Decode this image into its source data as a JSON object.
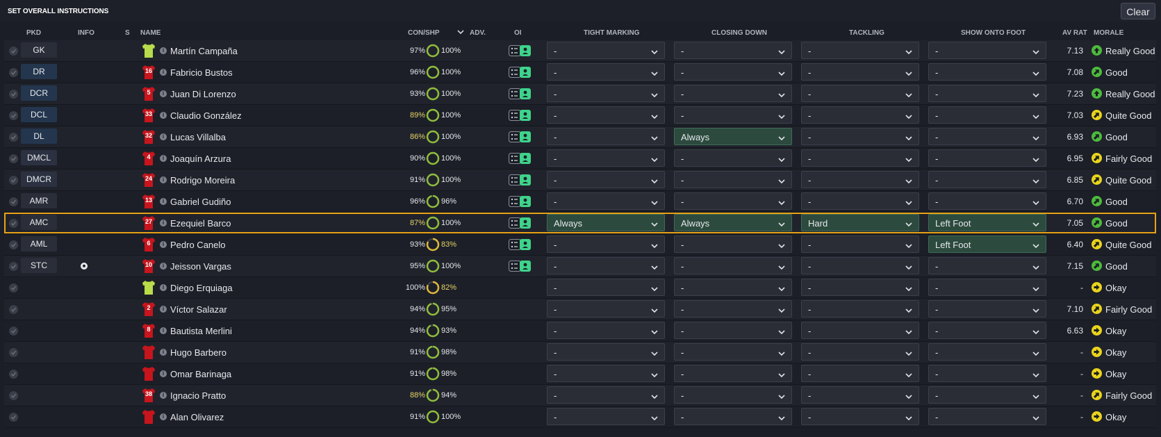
{
  "title": "SET OVERALL INSTRUCTIONS",
  "clear_label": "Clear",
  "columns": {
    "pkd": "PKD",
    "info": "INFO",
    "s": "S",
    "name": "NAME",
    "con_shp": "CON/SHP",
    "adv": "ADV.",
    "oi": "OI",
    "tight_marking": "TIGHT MARKING",
    "closing_down": "CLOSING DOWN",
    "tackling": "TACKLING",
    "show_onto_foot": "SHOW ONTO FOOT",
    "av_rat": "AV RAT",
    "morale": "MORALE"
  },
  "colors": {
    "highlight": "#e8a317",
    "active_dropdown": "#2c4a3e",
    "morale_green": "#4dbb3c",
    "morale_yellow": "#e9d41c",
    "ring_green": "#8fbd3a",
    "ring_yellow": "#e0b93a"
  },
  "players": [
    {
      "pos": "GK",
      "shirt": "",
      "kit": "gk",
      "name": "Martín Campaña",
      "con": "97%",
      "con_level": 0.97,
      "shp": "100%",
      "shp_level": 1.0,
      "oi": true,
      "tight": "-",
      "closing": "-",
      "tackling": "-",
      "foot": "-",
      "rating": "7.13",
      "morale": "Really Good",
      "morale_icon": "arrow-up-green"
    },
    {
      "pos": "DR",
      "shirt": "16",
      "kit": "red",
      "name": "Fabricio Bustos",
      "con": "96%",
      "con_level": 0.96,
      "shp": "100%",
      "shp_level": 1.0,
      "oi": true,
      "tight": "-",
      "closing": "-",
      "tackling": "-",
      "foot": "-",
      "rating": "7.08",
      "morale": "Good",
      "morale_icon": "arrow-green"
    },
    {
      "pos": "DCR",
      "shirt": "5",
      "kit": "red",
      "name": "Juan Di Lorenzo",
      "con": "93%",
      "con_level": 0.93,
      "shp": "100%",
      "shp_level": 1.0,
      "oi": true,
      "tight": "-",
      "closing": "-",
      "tackling": "-",
      "foot": "-",
      "rating": "7.23",
      "morale": "Really Good",
      "morale_icon": "arrow-up-green"
    },
    {
      "pos": "DCL",
      "shirt": "33",
      "kit": "red",
      "name": "Claudio González",
      "con": "89%",
      "con_level": 0.89,
      "shp": "100%",
      "shp_level": 1.0,
      "oi": true,
      "tight": "-",
      "closing": "-",
      "tackling": "-",
      "foot": "-",
      "rating": "7.03",
      "morale": "Quite Good",
      "morale_icon": "arrow-yellow"
    },
    {
      "pos": "DL",
      "shirt": "32",
      "kit": "red",
      "name": "Lucas Villalba",
      "con": "86%",
      "con_level": 0.86,
      "shp": "100%",
      "shp_level": 1.0,
      "oi": true,
      "tight": "-",
      "closing": "Always",
      "tackling": "-",
      "foot": "-",
      "rating": "6.93",
      "morale": "Good",
      "morale_icon": "arrow-green"
    },
    {
      "pos": "DMCL",
      "shirt": "4",
      "kit": "red",
      "name": "Joaquín Arzura",
      "con": "90%",
      "con_level": 0.9,
      "shp": "100%",
      "shp_level": 1.0,
      "oi": true,
      "tight": "-",
      "closing": "-",
      "tackling": "-",
      "foot": "-",
      "rating": "6.95",
      "morale": "Fairly Good",
      "morale_icon": "arrow-yellow"
    },
    {
      "pos": "DMCR",
      "shirt": "24",
      "kit": "red",
      "name": "Rodrigo Moreira",
      "con": "91%",
      "con_level": 0.91,
      "shp": "100%",
      "shp_level": 1.0,
      "oi": true,
      "tight": "-",
      "closing": "-",
      "tackling": "-",
      "foot": "-",
      "rating": "6.85",
      "morale": "Quite Good",
      "morale_icon": "arrow-yellow"
    },
    {
      "pos": "AMR",
      "shirt": "13",
      "kit": "red",
      "name": "Gabriel Gudiño",
      "con": "96%",
      "con_level": 0.96,
      "shp": "96%",
      "shp_level": 0.96,
      "oi": true,
      "tight": "-",
      "closing": "-",
      "tackling": "-",
      "foot": "-",
      "rating": "6.70",
      "morale": "Good",
      "morale_icon": "arrow-green"
    },
    {
      "pos": "AMC",
      "shirt": "27",
      "kit": "red",
      "name": "Ezequiel Barco",
      "con": "87%",
      "con_level": 0.87,
      "shp": "100%",
      "shp_level": 1.0,
      "oi": true,
      "tight": "Always",
      "closing": "Always",
      "tackling": "Hard",
      "foot": "Left Foot",
      "rating": "7.05",
      "morale": "Good",
      "morale_icon": "arrow-green",
      "selected": true
    },
    {
      "pos": "AML",
      "shirt": "6",
      "kit": "red",
      "name": "Pedro Canelo",
      "con": "93%",
      "con_level": 0.93,
      "shp": "83%",
      "shp_level": 0.83,
      "oi": true,
      "tight": "-",
      "closing": "-",
      "tackling": "-",
      "foot": "Left Foot",
      "rating": "6.40",
      "morale": "Quite Good",
      "morale_icon": "arrow-yellow"
    },
    {
      "pos": "STC",
      "shirt": "10",
      "kit": "red",
      "name": "Jeisson Vargas",
      "con": "95%",
      "con_level": 0.95,
      "shp": "100%",
      "shp_level": 1.0,
      "oi": true,
      "info_icon": true,
      "tight": "-",
      "closing": "-",
      "tackling": "-",
      "foot": "-",
      "rating": "7.15",
      "morale": "Good",
      "morale_icon": "arrow-green"
    },
    {
      "pos": "",
      "shirt": "",
      "kit": "gk",
      "name": "Diego Erquiaga",
      "con": "100%",
      "con_level": 1.0,
      "shp": "82%",
      "shp_level": 0.82,
      "oi": false,
      "tight": "-",
      "closing": "-",
      "tackling": "-",
      "foot": "-",
      "rating": "-",
      "morale": "Okay",
      "morale_icon": "arrow-right-yellow"
    },
    {
      "pos": "",
      "shirt": "2",
      "kit": "red",
      "name": "Víctor Salazar",
      "con": "94%",
      "con_level": 0.94,
      "shp": "95%",
      "shp_level": 0.95,
      "oi": false,
      "tight": "-",
      "closing": "-",
      "tackling": "-",
      "foot": "-",
      "rating": "7.10",
      "morale": "Fairly Good",
      "morale_icon": "arrow-yellow"
    },
    {
      "pos": "",
      "shirt": "8",
      "kit": "red",
      "name": "Bautista Merlini",
      "con": "94%",
      "con_level": 0.94,
      "shp": "93%",
      "shp_level": 0.93,
      "oi": false,
      "tight": "-",
      "closing": "-",
      "tackling": "-",
      "foot": "-",
      "rating": "6.63",
      "morale": "Okay",
      "morale_icon": "arrow-right-yellow"
    },
    {
      "pos": "",
      "shirt": "",
      "kit": "red",
      "name": "Hugo Barbero",
      "con": "91%",
      "con_level": 0.91,
      "shp": "98%",
      "shp_level": 0.98,
      "oi": false,
      "tight": "-",
      "closing": "-",
      "tackling": "-",
      "foot": "-",
      "rating": "-",
      "morale": "Okay",
      "morale_icon": "arrow-right-yellow"
    },
    {
      "pos": "",
      "shirt": "",
      "kit": "red",
      "name": "Omar Barinaga",
      "con": "91%",
      "con_level": 0.91,
      "shp": "98%",
      "shp_level": 0.98,
      "oi": false,
      "tight": "-",
      "closing": "-",
      "tackling": "-",
      "foot": "-",
      "rating": "-",
      "morale": "Okay",
      "morale_icon": "arrow-right-yellow"
    },
    {
      "pos": "",
      "shirt": "38",
      "kit": "red",
      "name": "Ignacio Pratto",
      "con": "88%",
      "con_level": 0.88,
      "shp": "94%",
      "shp_level": 0.94,
      "oi": false,
      "tight": "-",
      "closing": "-",
      "tackling": "-",
      "foot": "-",
      "rating": "-",
      "morale": "Fairly Good",
      "morale_icon": "arrow-yellow"
    },
    {
      "pos": "",
      "shirt": "",
      "kit": "red",
      "name": "Alan Olivarez",
      "con": "91%",
      "con_level": 0.91,
      "shp": "100%",
      "shp_level": 1.0,
      "oi": false,
      "tight": "-",
      "closing": "-",
      "tackling": "-",
      "foot": "-",
      "rating": "-",
      "morale": "Okay",
      "morale_icon": "arrow-right-yellow"
    }
  ]
}
